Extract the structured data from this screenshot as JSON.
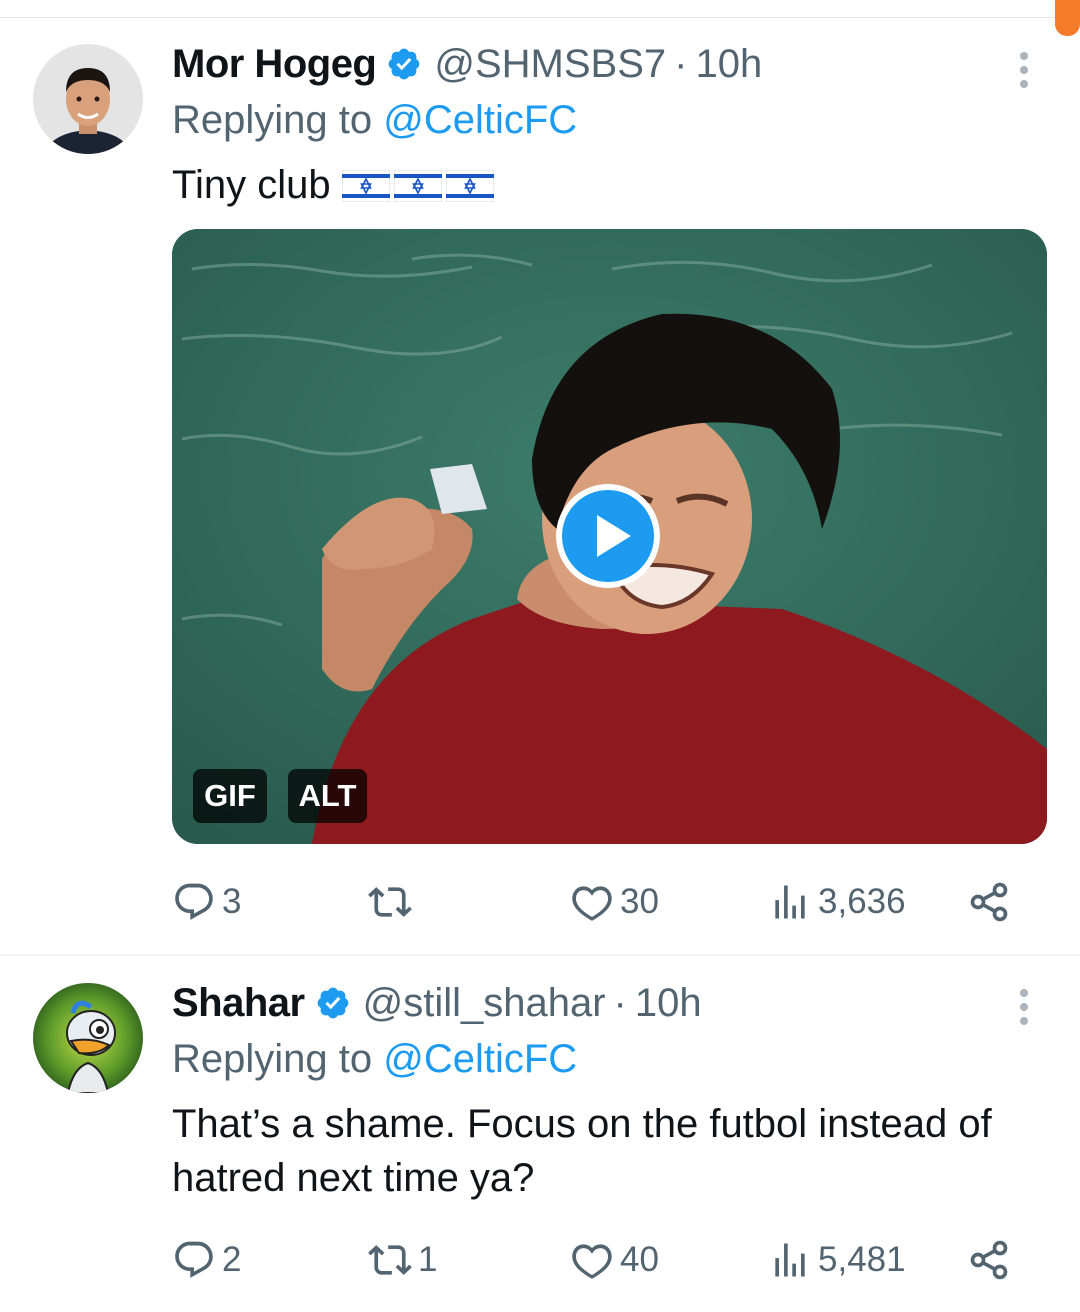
{
  "colors": {
    "accent": "#1d9bf0",
    "text": "#0f1419",
    "muted": "#536471",
    "scroll_indicator": "#f47b2a"
  },
  "tweets": [
    {
      "display_name": "Mor Hogeg",
      "verified": true,
      "handle": "@SHMSBS7",
      "separator": "·",
      "time": "10h",
      "replying_prefix": "Replying to",
      "replying_to": "@CelticFC",
      "text": "Tiny club",
      "flags": [
        "israel-flag",
        "israel-flag",
        "israel-flag"
      ],
      "media": {
        "type": "gif",
        "gif_badge": "GIF",
        "alt_badge": "ALT",
        "icon": "play-icon"
      },
      "actions": {
        "replies": "3",
        "retweets": "",
        "likes": "30",
        "views": "3,636"
      }
    },
    {
      "display_name": "Shahar",
      "verified": true,
      "handle": "@still_shahar",
      "separator": "·",
      "time": "10h",
      "replying_prefix": "Replying to",
      "replying_to": "@CelticFC",
      "text": "That’s a shame. Focus on the futbol instead of hatred next time ya?",
      "actions": {
        "replies": "2",
        "retweets": "1",
        "likes": "40",
        "views": "5,481"
      }
    }
  ]
}
